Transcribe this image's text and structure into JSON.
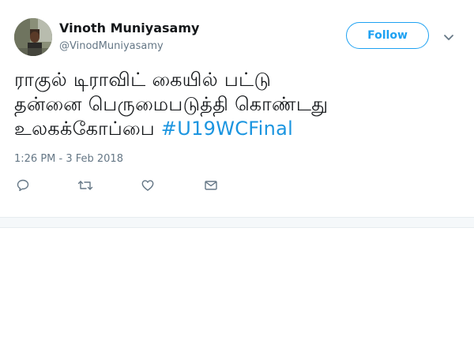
{
  "tweet": {
    "author_name": "Vinoth Muniyasamy",
    "author_handle": "@VinodMuniyasamy",
    "follow_label": "Follow",
    "text_line_1": "ராகுல் டிராவிட் கையில் பட்டு",
    "text_line_2": "தன்னை பெருமைபடுத்தி கொண்டது",
    "text_line_3": "உலகக்கோப்பை ",
    "hashtag": "#U19WCFinal",
    "timestamp": "1:26 PM - 3 Feb 2018"
  },
  "icons": {
    "reply": "reply-icon",
    "retweet": "retweet-icon",
    "like": "heart-icon",
    "message": "envelope-icon",
    "more": "chevron-down-icon"
  },
  "colors": {
    "accent": "#1da1f2",
    "hashtag": "#1b95e0",
    "text": "#14171a",
    "muted": "#657786",
    "icon": "#657786",
    "border": "#e6ecf0"
  }
}
